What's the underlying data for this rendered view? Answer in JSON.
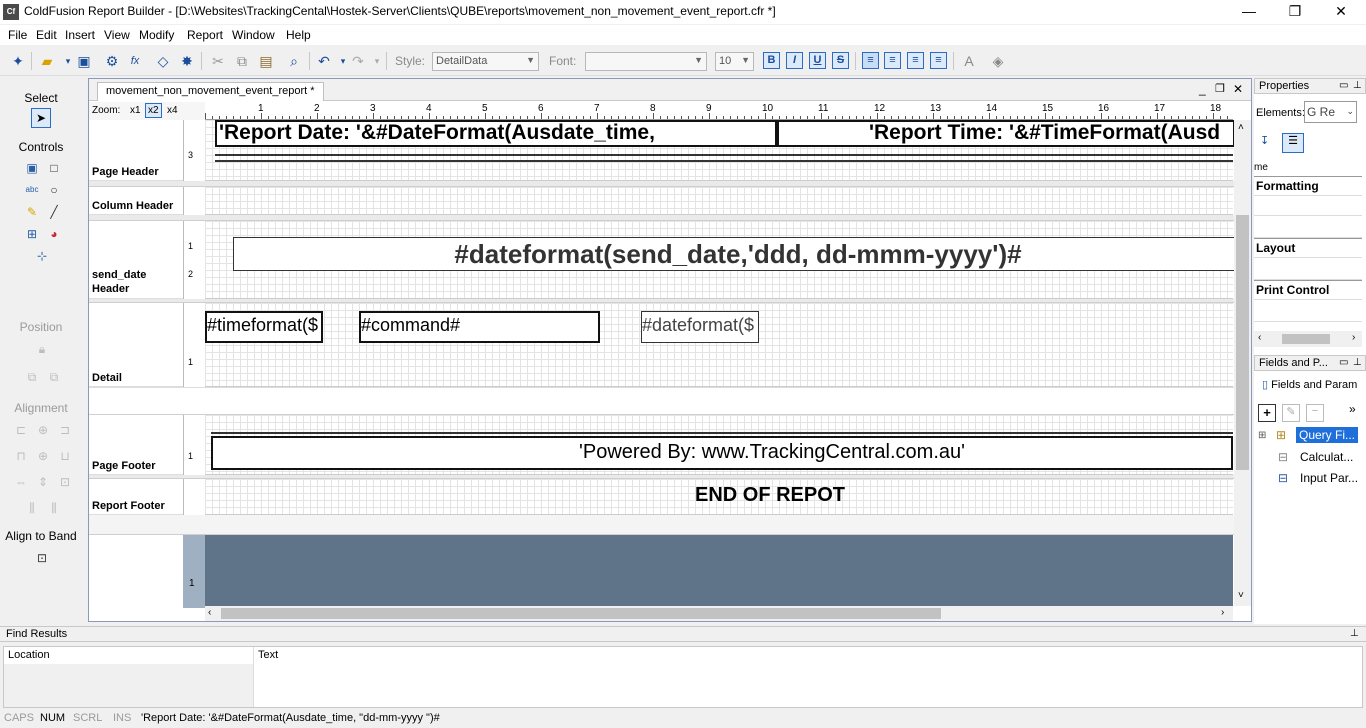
{
  "window": {
    "app_icon": "Cf",
    "title": "ColdFusion Report Builder - [D:\\Websites\\TrackingCental\\Hostek-Server\\Clients\\QUBE\\reports\\movement_non_movement_event_report.cfr *]",
    "minimize": "—",
    "restore": "❐",
    "close": "✕"
  },
  "menu": [
    "File",
    "Edit",
    "Insert",
    "View",
    "Modify",
    "Report",
    "Window",
    "Help"
  ],
  "toolbar": {
    "style_label": "Style:",
    "style_value": "DetailData",
    "font_label": "Font:",
    "font_value": "",
    "size_value": "10",
    "bold": "B",
    "italic": "I",
    "underline": "U",
    "strike": "S"
  },
  "palette": {
    "select": "Select",
    "controls": "Controls",
    "position": "Position",
    "alignment": "Alignment",
    "align_to_band": "Align to Band"
  },
  "document": {
    "tab": "movement_non_movement_event_report *",
    "zoom_label": "Zoom:",
    "zoom_options": [
      "x1",
      "x2",
      "x4"
    ],
    "ruler": [
      "1",
      "2",
      "3",
      "4",
      "5",
      "6",
      "7",
      "8",
      "9",
      "10",
      "11",
      "12",
      "13",
      "14",
      "15",
      "16",
      "17",
      "18"
    ]
  },
  "bands": {
    "page_header": "Page Header",
    "column_header": "Column Header",
    "send_date_header_1": "send_date",
    "send_date_header_2": "Header",
    "detail": "Detail",
    "page_footer": "Page Footer",
    "report_footer": "Report Footer"
  },
  "fields": {
    "report_date": "'Report Date: '&#DateFormat(Ausdate_time,",
    "report_time": "'Report Time: '&#TimeFormat(Ausd",
    "send_date": "#dateformat(send_date,'ddd, dd-mmm-yyyy')#",
    "timeformat": "#timeformat($",
    "command": "#command#",
    "dateformat_detail": "#dateformat($",
    "powered_by": "'Powered By: www.TrackingCentral.com.au'",
    "end_of_report": "END OF REPOT"
  },
  "properties": {
    "title": "Properties",
    "elements_label": "Elements:",
    "elements_value": "G  Re",
    "name_fragment": "me",
    "sections": [
      "Formatting",
      "Layout",
      "Print Control"
    ]
  },
  "fields_panel": {
    "title": "Fields and P...",
    "tab": "Fields and Param",
    "tree": [
      "Query Fi...",
      "Calculat...",
      "Input Par..."
    ]
  },
  "find": {
    "title": "Find Results",
    "col_location": "Location",
    "col_text": "Text"
  },
  "status": {
    "caps": "CAPS",
    "num": "NUM",
    "scrl": "SCRL",
    "ins": "INS",
    "message": "'Report Date: '&#DateFormat(Ausdate_time, \"dd-mm-yyyy \")#"
  },
  "colors": {
    "accent": "#2b6cc4",
    "gray_area": "#5f7488"
  }
}
